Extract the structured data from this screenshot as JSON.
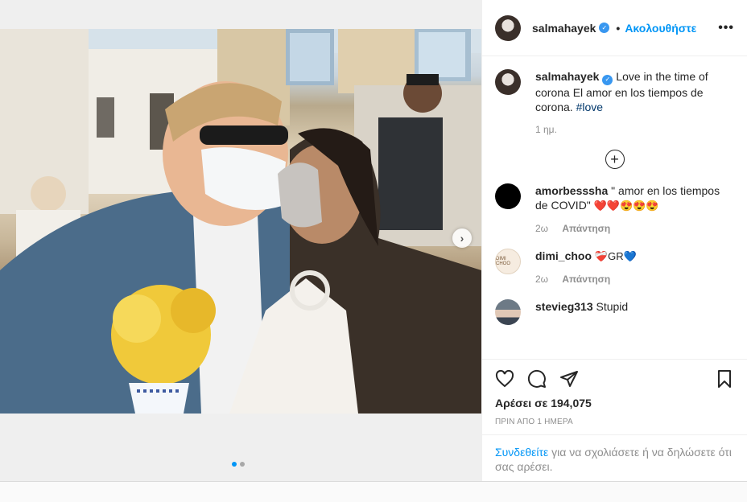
{
  "header": {
    "username": "salmahayek",
    "follow_label": "Ακολουθήστε",
    "bullet": "•",
    "more_label": "•••"
  },
  "media": {
    "next_arrow": "›",
    "dots_total": 2,
    "dots_active": 0
  },
  "caption": {
    "username": "salmahayek",
    "text": "Love in the time of corona El amor en los tiempos de corona.",
    "hashtag": "#love",
    "time": "1 ημ."
  },
  "comments": [
    {
      "username": "amorbesssha",
      "text": "\" amor en los tiempos de COVID\"",
      "emoji": "❤️❤️😍😍😍",
      "time": "2ω",
      "reply": "Απάντηση"
    },
    {
      "username": "dimi_choo",
      "avatar_text": "DIMI CHOO",
      "text": "",
      "emoji": "❤️‍🩹GR💙",
      "time": "2ω",
      "reply": "Απάντηση"
    },
    {
      "username": "stevieg313",
      "text": "Stupid"
    }
  ],
  "actions": {
    "likes": "Αρέσει σε 194,075",
    "date": "ΠΡΙΝ ΑΠΟ 1 ΗΜΕΡΑ"
  },
  "login": {
    "link": "Συνδεθείτε",
    "text": " για να σχολιάσετε ή να δηλώσετε ότι σας αρέσει."
  },
  "colors": {
    "accent": "#0095f6",
    "verified": "#3897f0",
    "text": "#262626",
    "muted": "#8e8e8e"
  }
}
